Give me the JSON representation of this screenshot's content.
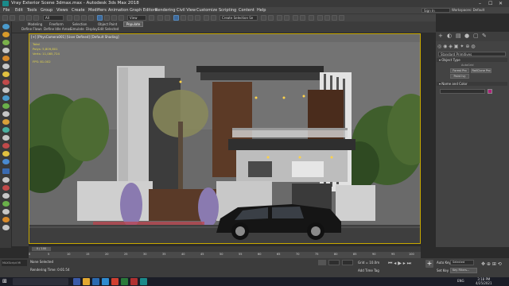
{
  "window": {
    "title": "Vray Exterior Scene 3dmax.max - Autodesk 3ds Max 2018"
  },
  "window_controls": {
    "minimize": "–",
    "maximize": "☐",
    "close": "✕"
  },
  "menus": [
    "File",
    "Edit",
    "Tools",
    "Group",
    "Views",
    "Create",
    "Modifiers",
    "Animation",
    "Graph Editors",
    "Rendering",
    "Civil View",
    "Customize",
    "Scripting",
    "Content",
    "Help"
  ],
  "account": {
    "signin": "Sign In",
    "workspaces_label": "Workspaces:",
    "workspace_value": "Default"
  },
  "toolbar": {
    "view_dropdown": "View",
    "create_selection_set": "Create Selection Se",
    "filter_all": "All"
  },
  "ribbon": {
    "tabs": [
      "Modeling",
      "Freeform",
      "Selection",
      "Object Paint",
      "Populate"
    ],
    "sub": [
      "Define Flows",
      "Define Idle Areas",
      "Simulate",
      "Display",
      "Edit Selected"
    ]
  },
  "viewport": {
    "label": "[+] [PhysCamera001] [User Defined] [Default Shading]",
    "stats": {
      "total_label": "Total",
      "polys_label": "Polys:",
      "polys_value": "5,809,801",
      "verts_label": "Verts:",
      "verts_value": "11,085,724",
      "fps_label": "FPS:",
      "fps_value": "81.002"
    }
  },
  "command_panel": {
    "dropdown": "Standard Primitives",
    "object_type_header": "Object Type",
    "autogrid": "AutoGrid",
    "buttons": [
      "Forest Pro",
      "RailClone Pro",
      "Paint Ivy"
    ],
    "name_color_header": "Name and Color",
    "swatch_color": "#b0207a"
  },
  "timeline": {
    "frame": "0 / 100"
  },
  "ruler_ticks": [
    "0",
    "5",
    "10",
    "15",
    "20",
    "25",
    "30",
    "35",
    "40",
    "45",
    "50",
    "55",
    "60",
    "65",
    "70",
    "75",
    "80",
    "85",
    "90",
    "95",
    "100"
  ],
  "status": {
    "selection": "None Selected",
    "rendering_time": "Rendering Time: 0:01:54",
    "maxscript": "MAXScript Mi",
    "grid": "Grid = 10.0m",
    "add_time_tag": "Add Time Tag",
    "auto_key": "Auto Key",
    "set_key": "Set Key",
    "selected": "Selected",
    "key_filters": "Key Filters..."
  },
  "taskbar": {
    "time": "3:18 PM",
    "date": "4/25/2021",
    "lang": "ENG"
  }
}
